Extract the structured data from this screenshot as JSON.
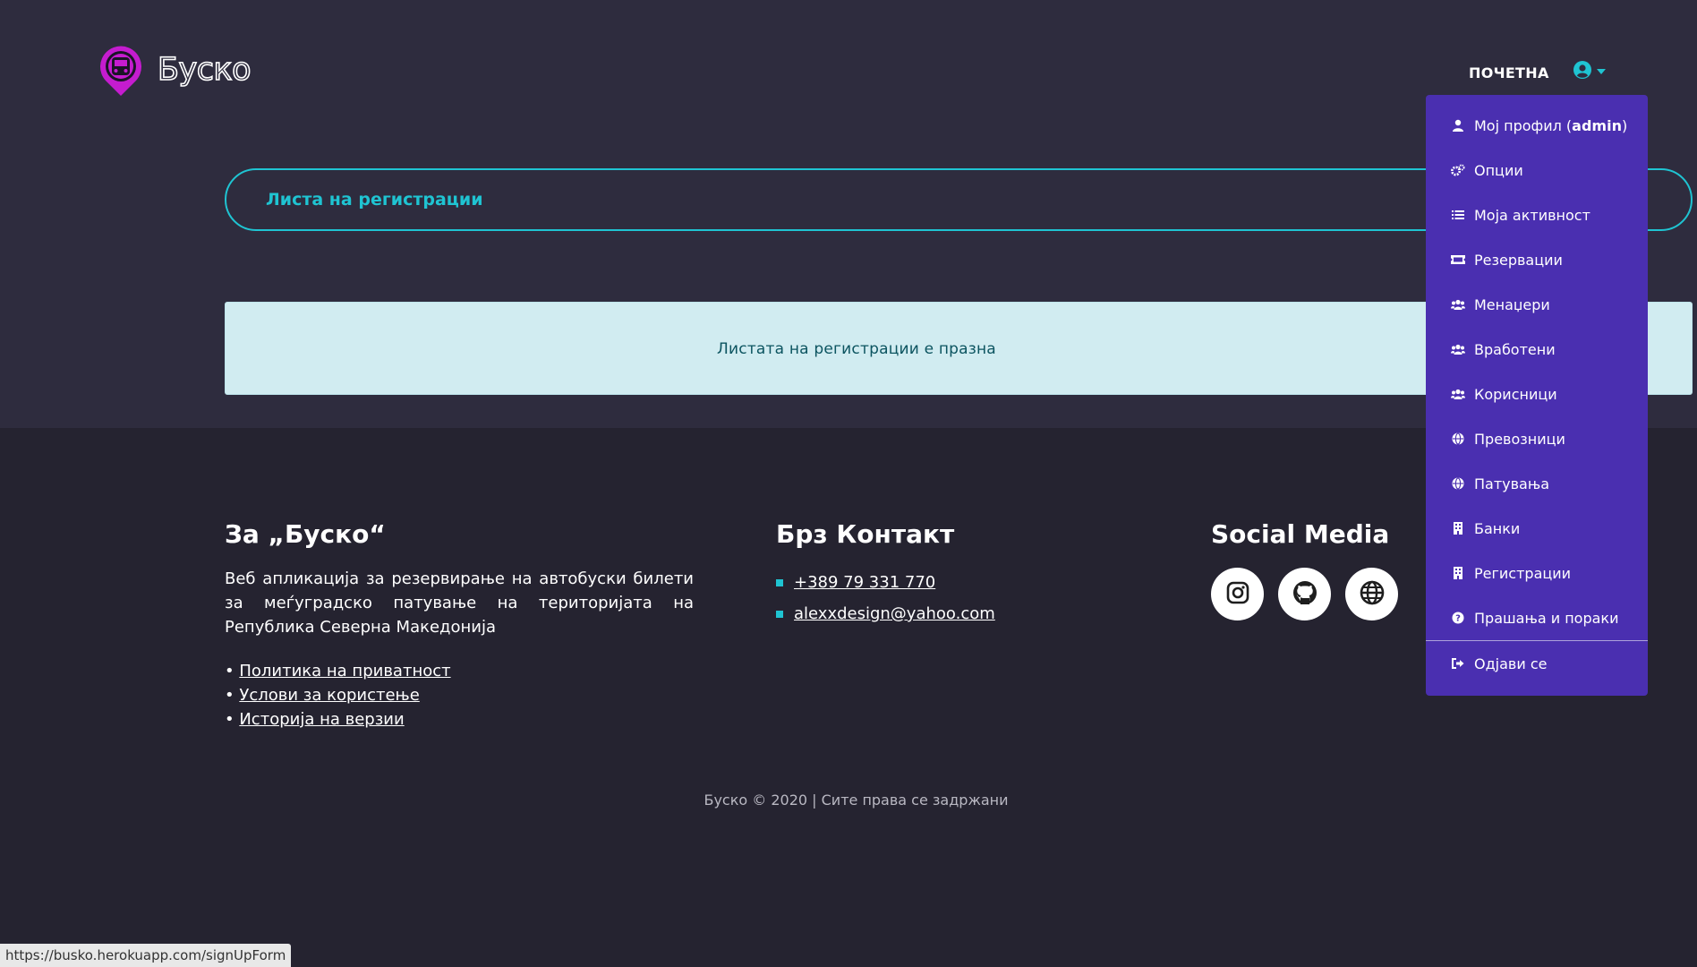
{
  "header": {
    "brand": "Буско",
    "nav_home": "ПОЧЕТНА"
  },
  "main": {
    "title": "Листа на регистрации",
    "empty_message": "Листата на регистрации е празна"
  },
  "dropdown": {
    "profile_prefix": "Мој профил (",
    "profile_user": "admin",
    "profile_suffix": ")",
    "items": [
      {
        "label": "Опции",
        "icon": "cogs-icon"
      },
      {
        "label": "Моја активност",
        "icon": "list-icon"
      },
      {
        "label": "Резервации",
        "icon": "ticket-icon"
      },
      {
        "label": "Менаџери",
        "icon": "users-icon"
      },
      {
        "label": "Вработени",
        "icon": "users-icon"
      },
      {
        "label": "Корисници",
        "icon": "users-icon"
      },
      {
        "label": "Превозници",
        "icon": "globe-icon"
      },
      {
        "label": "Патувања",
        "icon": "globe-icon"
      },
      {
        "label": "Банки",
        "icon": "building-icon"
      },
      {
        "label": "Регистрации",
        "icon": "building-icon"
      },
      {
        "label": "Прашања и пораки",
        "icon": "question-circle-icon"
      }
    ],
    "logout": "Одјави се"
  },
  "footer": {
    "about_title": "За „Буско“",
    "about_text": "Веб апликација за резервирање на автобуски билети за меѓуградско патување на територијата на Република Северна Македонија",
    "links": [
      "Политика на приватност",
      "Услови за користење",
      "Историја на верзии"
    ],
    "contact_title": "Брз Контакт",
    "phone": "+389 79 331 770",
    "email": "alexxdesign@yahoo.com",
    "social_title": "Social Media",
    "socials": [
      "instagram-icon",
      "github-icon",
      "globe-icon"
    ],
    "copyright": "Буско © 2020 | Сите права се задржани"
  },
  "status_bar": {
    "url": "https://busko.herokuapp.com/signUpForm"
  },
  "colors": {
    "accent": "#1fc4d2",
    "dropdown_bg": "#4a2fb0",
    "logo": "#c51ccf"
  }
}
